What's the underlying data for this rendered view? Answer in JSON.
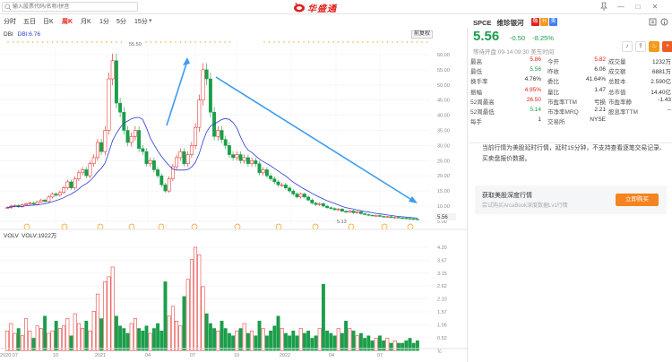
{
  "search": {
    "placeholder": "输入股票代码/名称/拼音"
  },
  "brand": {
    "name": "华盛通"
  },
  "window": {
    "min": "—",
    "max": "□",
    "close": "✕"
  },
  "toolbar": {
    "items": [
      "分时",
      "五日",
      "日K",
      "周K",
      "月K",
      "1分",
      "5分",
      "15分"
    ],
    "active_index": 3,
    "fifteen_dropdown": "▾"
  },
  "main_chart": {
    "indicator_name": "DBI",
    "indicator_value": "DBI:6.76",
    "restore_label": "前复权",
    "y_ticks": [
      "60.00",
      "55.00",
      "50.00",
      "45.00",
      "40.00",
      "35.00",
      "30.00",
      "25.00",
      "20.00",
      "15.00",
      "10.00",
      "5.00"
    ],
    "last_price_label": "5.56",
    "high_label": "55.50",
    "low_label": "5.13",
    "x_labels": [
      "2020.07",
      "10",
      "2021",
      "04",
      "07",
      "10",
      "2022",
      "04",
      "07"
    ]
  },
  "volume_chart": {
    "indicator_name": "VOLV",
    "indicator_value": "VOLV:1922万",
    "y_ticks": [
      "4.20",
      "3.67",
      "3.15",
      "2.62",
      "2.10",
      "1.57",
      "1.05",
      "0.52",
      "亿"
    ]
  },
  "quote": {
    "symbol": "SPCE",
    "name": "维珍银河",
    "tags": [
      "融",
      "H",
      "美"
    ],
    "price": "5.56",
    "change": "-0.50",
    "change_pct": "-8.25%",
    "market_state": "等待开盘 09-14 09:30 美东时间",
    "rows": [
      [
        "最高",
        "5.86",
        "今开",
        "5.82",
        "成交量",
        "1232万"
      ],
      [
        "最低",
        "5.56",
        "昨收",
        "6.06",
        "成交额",
        "6881万"
      ],
      [
        "换手率",
        "4.76%",
        "委比",
        "41.64%",
        "总股本",
        "2.590亿"
      ],
      [
        "振幅",
        "4.95%",
        "量比",
        "1.47",
        "总市值",
        "14.40亿"
      ],
      [
        "52周最高",
        "26.50",
        "市盈率TTM",
        "亏损",
        "市盈率静",
        "-1.43"
      ],
      [
        "52周最低",
        "5.14",
        "市净率MRQ",
        "2.21",
        "股息率TTM",
        "--"
      ],
      [
        "每手",
        "1",
        "交易所",
        "NYSE",
        "",
        ""
      ]
    ]
  },
  "notice": {
    "text": "当前行情为美股延时行情，延时15分钟，不支持查看逐笔交易记录、买卖盘报价数据。"
  },
  "promo": {
    "title": "获取美股深度行情",
    "subtitle": "尝试购买ArcaBook深度数据Lv1行情",
    "button": "立即购买"
  },
  "colors": {
    "up": "#e0201b",
    "down": "#1b9e4b",
    "ma": "#2a3bd5",
    "annotation": "#3b9cf0",
    "brand": "#e0201b",
    "promo_button": "#f5831f"
  }
}
